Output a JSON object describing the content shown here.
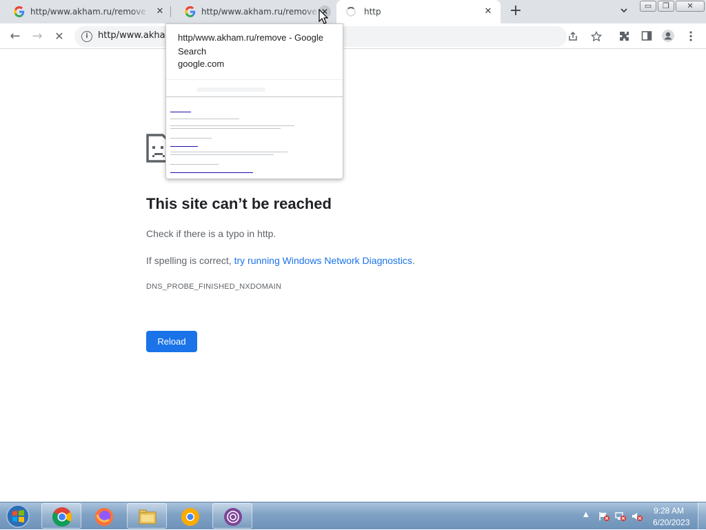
{
  "tabs": [
    {
      "title": "http/www.akham.ru/remove - Google Search",
      "close": "✕"
    },
    {
      "title": "http/www.akham.ru/remove - Google Search",
      "close": "✕"
    },
    {
      "title": "http",
      "close": "✕"
    }
  ],
  "new_tab_glyph": "+",
  "tab_list_glyph": "⌄",
  "window_controls": {
    "minimize": "▭",
    "restore": "❐",
    "close": "✕"
  },
  "toolbar": {
    "back": "←",
    "forward": "→",
    "stop": "✕",
    "url": "http/www.akham.ru/remove",
    "icons": [
      "share-icon",
      "bookmark-star-icon",
      "extensions-icon",
      "side-panel-icon",
      "profile-icon",
      "menu-icon"
    ]
  },
  "hovercard": {
    "title": "http/www.akham.ru/remove - Google Search",
    "domain": "google.com"
  },
  "error": {
    "heading": "This site can’t be reached",
    "line1": "Check if there is a typo in http.",
    "line2_prefix": "If spelling is correct, ",
    "line2_link": "try running Windows Network Diagnostics",
    "line2_suffix": ".",
    "code": "DNS_PROBE_FINISHED_NXDOMAIN",
    "reload": "Reload"
  },
  "taskbar": {
    "apps": [
      "chrome-icon",
      "firefox-icon",
      "file-explorer-icon",
      "chrome-canary-icon",
      "tor-browser-icon"
    ],
    "tray_glyph": "▲",
    "time": "9:28 AM",
    "date": "6/20/2023"
  },
  "colors": {
    "accent": "#1a73e8",
    "tabstrip": "#dee1e6"
  }
}
